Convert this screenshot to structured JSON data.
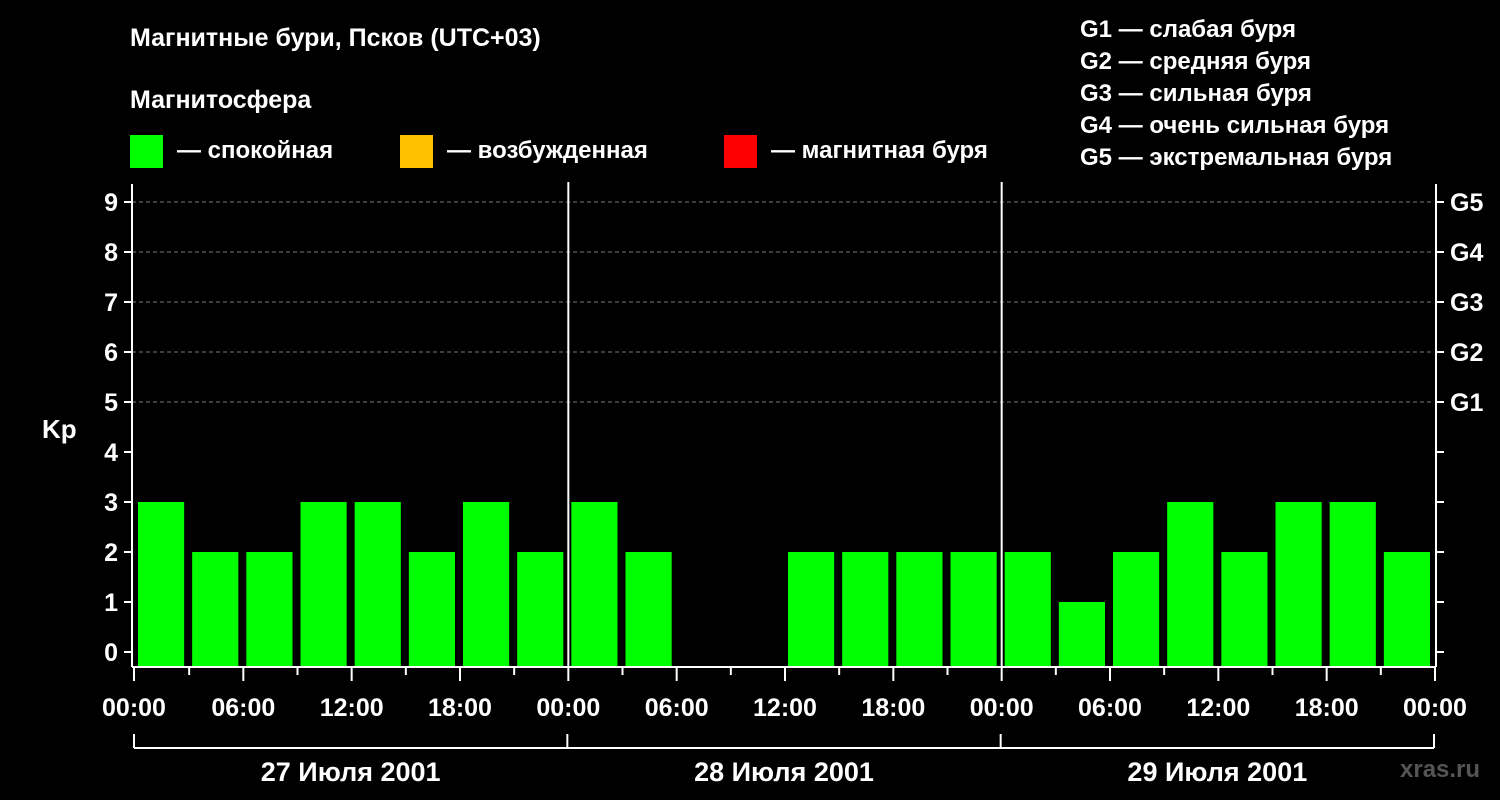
{
  "header": {
    "title": "Магнитные бури, Псков (UTC+03)",
    "subtitle": "Магнитосфера"
  },
  "legend": [
    {
      "label": "— спокойная",
      "color": "#00ff00"
    },
    {
      "label": "— возбужденная",
      "color": "#ffc000"
    },
    {
      "label": "— магнитная буря",
      "color": "#ff0000"
    }
  ],
  "storm_levels": [
    "G1 — слабая буря",
    "G2 — средняя буря",
    "G3 — сильная буря",
    "G4 — очень сильная буря",
    "G5 — экстремальная буря"
  ],
  "watermark": "xras.ru",
  "chart_data": {
    "type": "bar",
    "ylabel": "Kp",
    "ylim": [
      0,
      9
    ],
    "yticks": [
      0,
      1,
      2,
      3,
      4,
      5,
      6,
      7,
      8,
      9
    ],
    "right_axis_labels": [
      {
        "kp": 5,
        "label": "G1"
      },
      {
        "kp": 6,
        "label": "G2"
      },
      {
        "kp": 7,
        "label": "G3"
      },
      {
        "kp": 8,
        "label": "G4"
      },
      {
        "kp": 9,
        "label": "G5"
      }
    ],
    "grid": true,
    "x_tick_labels": [
      "00:00",
      "06:00",
      "12:00",
      "18:00",
      "00:00",
      "06:00",
      "12:00",
      "18:00",
      "00:00",
      "06:00",
      "12:00",
      "18:00",
      "00:00"
    ],
    "days": [
      "27 Июля 2001",
      "28 Июля 2001",
      "29 Июля 2001"
    ],
    "series": [
      {
        "values": [
          3,
          2,
          2,
          3,
          3,
          2,
          3,
          2,
          3,
          2,
          null,
          null,
          2,
          2,
          2,
          2,
          2,
          1,
          2,
          3,
          2,
          3,
          3,
          2
        ],
        "color": "#00ff00"
      }
    ]
  }
}
